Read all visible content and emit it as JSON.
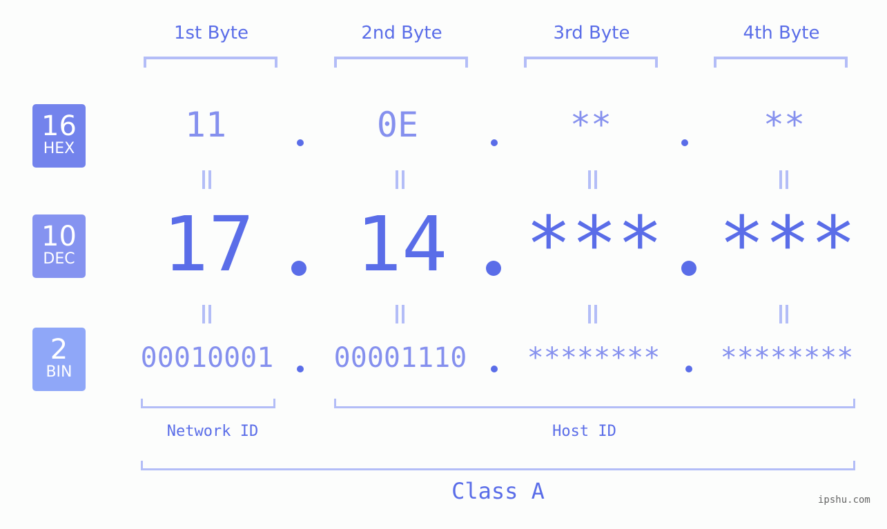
{
  "byte_headers": [
    "1st Byte",
    "2nd Byte",
    "3rd Byte",
    "4th Byte"
  ],
  "badges": {
    "hex": {
      "base": "16",
      "label": "HEX",
      "color": "#7383ec"
    },
    "dec": {
      "base": "10",
      "label": "DEC",
      "color": "#8593f0"
    },
    "bin": {
      "base": "2",
      "label": "BIN",
      "color": "#8fa7f8"
    }
  },
  "hex_values": [
    "11",
    "0E",
    "**",
    "**"
  ],
  "dec_values": [
    "17",
    "14",
    "***",
    "***"
  ],
  "bin_values": [
    "00010001",
    "00001110",
    "********",
    "********"
  ],
  "separator": ".",
  "network_id_label": "Network ID",
  "host_id_label": "Host ID",
  "class_label": "Class A",
  "watermark": "ipshu.com",
  "colors": {
    "accent": "#5a6de8",
    "light_value": "#8590ee",
    "bracket": "#b3bdf7",
    "background": "#fcfdfc"
  }
}
